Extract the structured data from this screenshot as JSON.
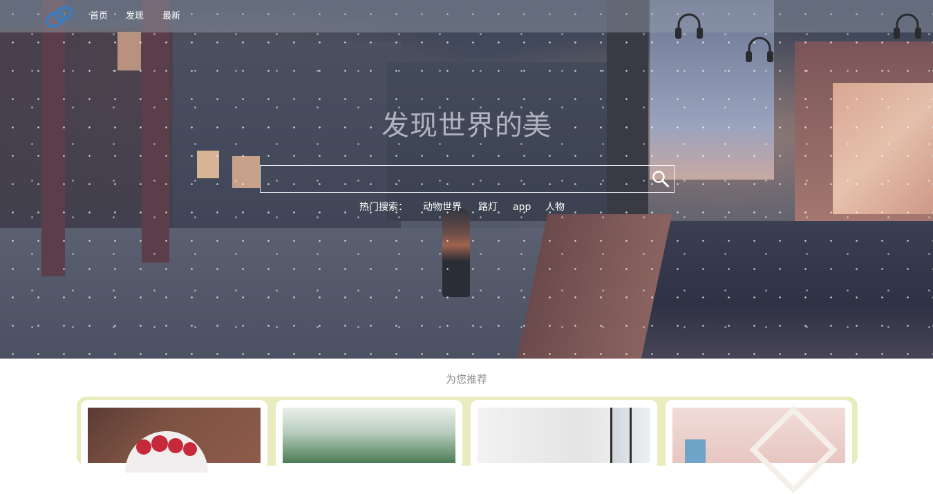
{
  "nav": {
    "logo_icon": "logo-icon",
    "links": [
      "首页",
      "发现",
      "最新"
    ]
  },
  "hero": {
    "title": "发现世界的美",
    "search": {
      "value": "",
      "placeholder": "",
      "button_icon": "search-icon"
    },
    "hot_search": {
      "label": "热门搜索：",
      "items": [
        "动物世界",
        "路灯",
        "app",
        "人物"
      ]
    }
  },
  "recommend": {
    "title": "为您推荐",
    "strip_color": "#e9ecbf",
    "cards": [
      {
        "image": "raspberry-bowl-photo"
      },
      {
        "image": "green-plant-photo"
      },
      {
        "image": "white-room-window-photo"
      },
      {
        "image": "pink-wall-frame-photo"
      }
    ]
  }
}
